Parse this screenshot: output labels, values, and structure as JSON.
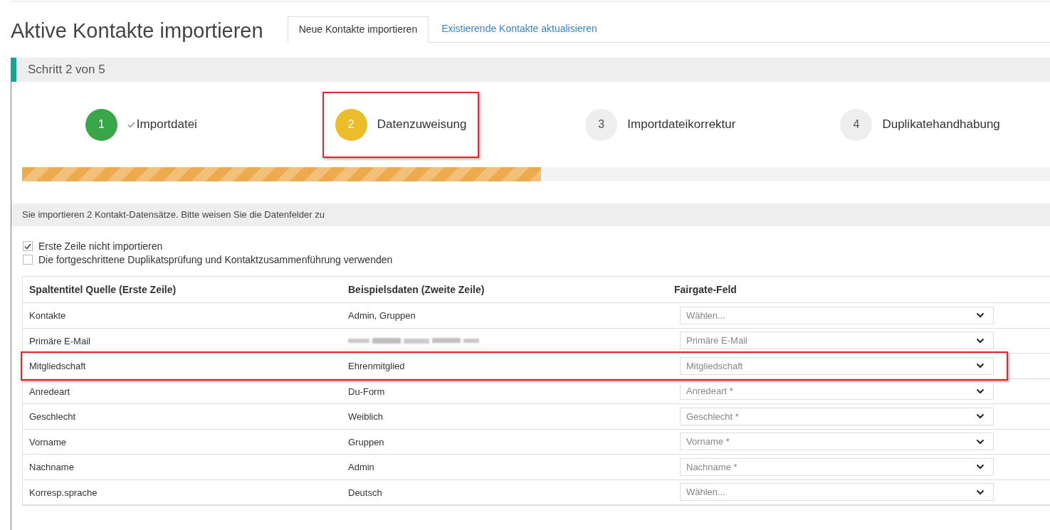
{
  "title": "Aktive Kontakte importieren",
  "tabs": [
    {
      "label": "Neue Kontakte importieren",
      "selected": true
    },
    {
      "label": "Existierende Kontakte aktualisieren",
      "selected": false
    }
  ],
  "panel": {
    "title": "Schritt 2 von 5"
  },
  "steps": [
    {
      "number": "1",
      "label": "Importdatei",
      "completed": true,
      "selected": false,
      "highlighted": false
    },
    {
      "number": "2",
      "label": "Datenzuweisung",
      "completed": false,
      "selected": true,
      "highlighted": true
    },
    {
      "number": "3",
      "label": "Importdateikorrektur",
      "completed": false,
      "selected": false,
      "highlighted": false
    },
    {
      "number": "4",
      "label": "Duplikatehandhabung",
      "completed": false,
      "selected": false,
      "highlighted": false
    }
  ],
  "progress": {
    "level": 0.505
  },
  "info": "Sie importieren 2 Kontakt-Datensätze. Bitte weisen Sie die Datenfelder zu",
  "options": [
    {
      "label": "Erste Zeile nicht importieren",
      "checked": true
    },
    {
      "label": "Die fortgeschrittene Duplikatsprüfung und Kontaktzusammenführung verwenden",
      "checked": false
    }
  ],
  "table": {
    "columns": [
      "Spaltentitel Quelle (Erste Zeile)",
      "Beispielsdaten (Zweite Zeile)",
      "Fairgate-Feld"
    ],
    "rows": [
      {
        "source": "Kontakte",
        "sample": "Admin, Gruppen",
        "redacted": false,
        "field": "Wählen...",
        "highlighted": false
      },
      {
        "source": "Primäre E-Mail",
        "redacted": true,
        "field": "Primäre E-Mail",
        "highlighted": false
      },
      {
        "source": "Mitgliedschaft",
        "sample": "Ehrenmitglied",
        "redacted": false,
        "field": "Mitgliedschaft",
        "highlighted": true
      },
      {
        "source": "Anredeart",
        "sample": "Du-Form",
        "redacted": false,
        "field": "Anredeart *",
        "highlighted": false
      },
      {
        "source": "Geschlecht",
        "sample": "Weiblich",
        "redacted": false,
        "field": "Geschlecht *",
        "highlighted": false
      },
      {
        "source": "Vorname",
        "sample": "Gruppen",
        "redacted": false,
        "field": "Vorname *",
        "highlighted": false
      },
      {
        "source": "Nachname",
        "sample": "Admin",
        "redacted": false,
        "field": "Nachname *",
        "highlighted": false
      },
      {
        "source": "Korresp.sprache",
        "sample": "Deutsch",
        "redacted": false,
        "field": "Wählen...",
        "highlighted": false
      }
    ]
  }
}
